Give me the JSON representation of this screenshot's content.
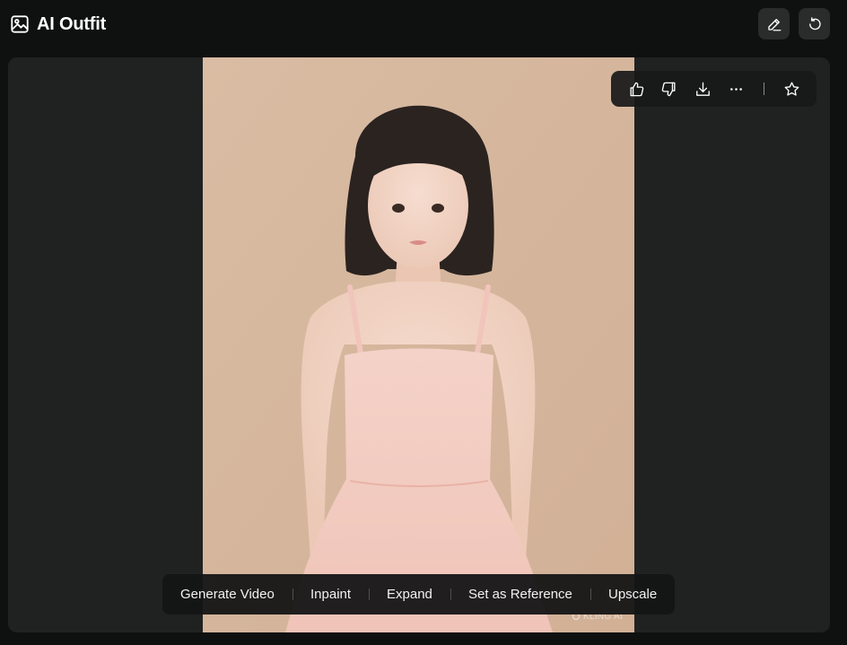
{
  "header": {
    "title": "AI Outfit",
    "title_icon": "image-icon",
    "edit_icon": "pencil-icon",
    "undo_icon": "undo-icon"
  },
  "toolbar": {
    "like_icon": "thumbs-up-icon",
    "dislike_icon": "thumbs-down-icon",
    "download_icon": "download-icon",
    "more_icon": "more-icon",
    "favorite_icon": "star-icon"
  },
  "image": {
    "watermark": "KLING AI"
  },
  "actions": [
    {
      "label": "Generate Video"
    },
    {
      "label": "Inpaint"
    },
    {
      "label": "Expand"
    },
    {
      "label": "Set as Reference"
    },
    {
      "label": "Upscale"
    }
  ],
  "colors": {
    "app_bg": "#0f1110",
    "panel_bg": "#202221",
    "photo_bg": "#d6b79c",
    "dress": "#f2c9bd"
  }
}
